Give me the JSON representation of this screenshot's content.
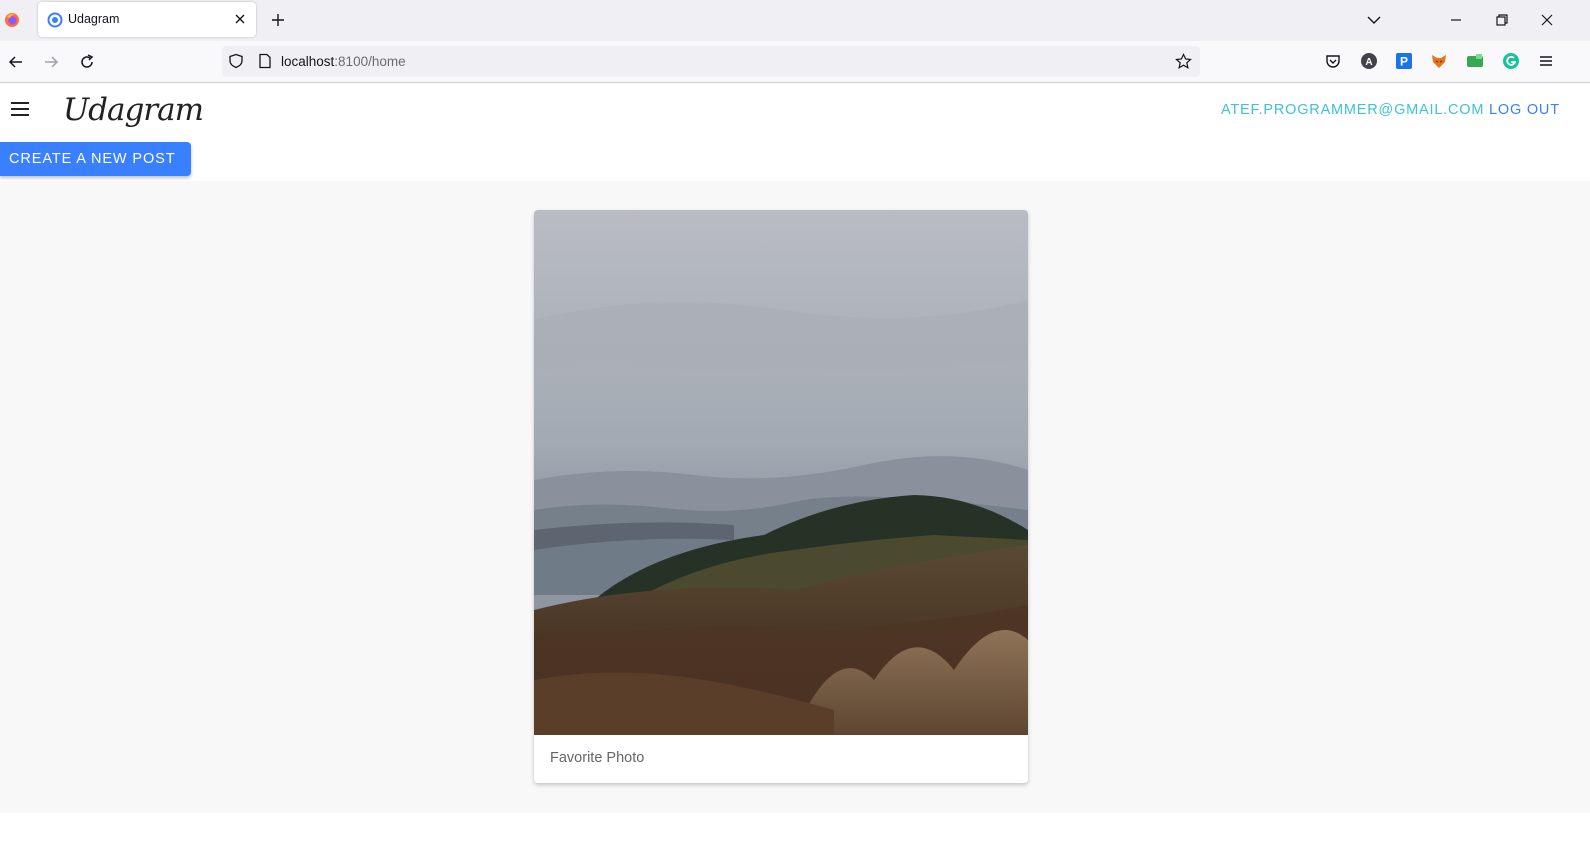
{
  "browser": {
    "tab_title": "Udagram",
    "url_host": "localhost",
    "url_rest": ":8100/home",
    "icons": [
      "firefox-logo",
      "tab-favicon",
      "tab-close",
      "new-tab",
      "list-all-tabs",
      "minimize",
      "restore",
      "close",
      "back",
      "forward",
      "reload",
      "tracking-shield",
      "page-info",
      "bookmark-star",
      "pocket",
      "account",
      "extension-p",
      "extension-fox",
      "extension-green",
      "grammarly",
      "app-menu"
    ]
  },
  "header": {
    "brand": "Udagram",
    "user_email": "ATEF.PROGRAMMER@GMAIL.COM",
    "logout_label": "LOG OUT"
  },
  "actions": {
    "create_post_label": "CREATE A NEW POST"
  },
  "feed": {
    "posts": [
      {
        "caption": "Favorite Photo",
        "image": "landscape-photo"
      }
    ]
  },
  "colors": {
    "primary": "#3880ff",
    "secondary": "#3dc2d7",
    "content_bg": "#f8f8f8"
  }
}
